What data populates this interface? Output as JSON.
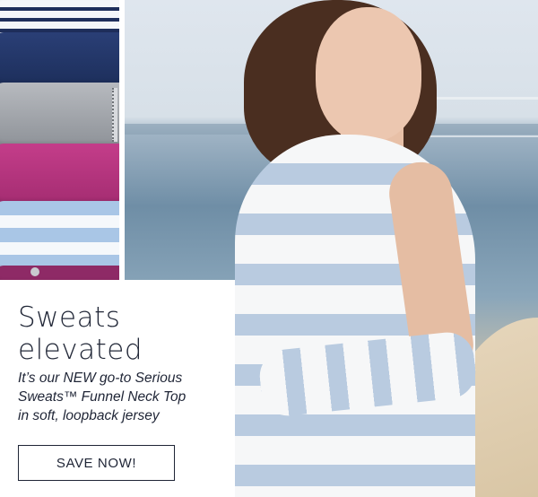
{
  "promo": {
    "headline_line1": "Sweats",
    "headline_line2": "elevated",
    "subline_1": "It’s our NEW go-to Serious",
    "subline_2": "Sweats™ Funnel Neck Top",
    "subline_3": "in soft, loopback jersey",
    "cta_label": "SAVE NOW!"
  },
  "colors": {
    "text": "#1f2536",
    "background": "#ffffff",
    "stripe_blue": "#b9cbe0"
  }
}
